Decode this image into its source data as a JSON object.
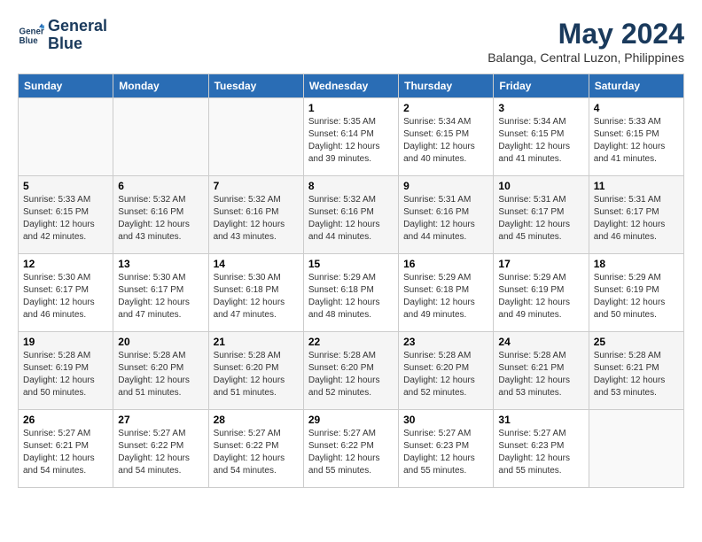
{
  "logo": {
    "line1": "General",
    "line2": "Blue"
  },
  "title": "May 2024",
  "location": "Balanga, Central Luzon, Philippines",
  "weekdays": [
    "Sunday",
    "Monday",
    "Tuesday",
    "Wednesday",
    "Thursday",
    "Friday",
    "Saturday"
  ],
  "weeks": [
    [
      {
        "day": "",
        "info": ""
      },
      {
        "day": "",
        "info": ""
      },
      {
        "day": "",
        "info": ""
      },
      {
        "day": "1",
        "info": "Sunrise: 5:35 AM\nSunset: 6:14 PM\nDaylight: 12 hours\nand 39 minutes."
      },
      {
        "day": "2",
        "info": "Sunrise: 5:34 AM\nSunset: 6:15 PM\nDaylight: 12 hours\nand 40 minutes."
      },
      {
        "day": "3",
        "info": "Sunrise: 5:34 AM\nSunset: 6:15 PM\nDaylight: 12 hours\nand 41 minutes."
      },
      {
        "day": "4",
        "info": "Sunrise: 5:33 AM\nSunset: 6:15 PM\nDaylight: 12 hours\nand 41 minutes."
      }
    ],
    [
      {
        "day": "5",
        "info": "Sunrise: 5:33 AM\nSunset: 6:15 PM\nDaylight: 12 hours\nand 42 minutes."
      },
      {
        "day": "6",
        "info": "Sunrise: 5:32 AM\nSunset: 6:16 PM\nDaylight: 12 hours\nand 43 minutes."
      },
      {
        "day": "7",
        "info": "Sunrise: 5:32 AM\nSunset: 6:16 PM\nDaylight: 12 hours\nand 43 minutes."
      },
      {
        "day": "8",
        "info": "Sunrise: 5:32 AM\nSunset: 6:16 PM\nDaylight: 12 hours\nand 44 minutes."
      },
      {
        "day": "9",
        "info": "Sunrise: 5:31 AM\nSunset: 6:16 PM\nDaylight: 12 hours\nand 44 minutes."
      },
      {
        "day": "10",
        "info": "Sunrise: 5:31 AM\nSunset: 6:17 PM\nDaylight: 12 hours\nand 45 minutes."
      },
      {
        "day": "11",
        "info": "Sunrise: 5:31 AM\nSunset: 6:17 PM\nDaylight: 12 hours\nand 46 minutes."
      }
    ],
    [
      {
        "day": "12",
        "info": "Sunrise: 5:30 AM\nSunset: 6:17 PM\nDaylight: 12 hours\nand 46 minutes."
      },
      {
        "day": "13",
        "info": "Sunrise: 5:30 AM\nSunset: 6:17 PM\nDaylight: 12 hours\nand 47 minutes."
      },
      {
        "day": "14",
        "info": "Sunrise: 5:30 AM\nSunset: 6:18 PM\nDaylight: 12 hours\nand 47 minutes."
      },
      {
        "day": "15",
        "info": "Sunrise: 5:29 AM\nSunset: 6:18 PM\nDaylight: 12 hours\nand 48 minutes."
      },
      {
        "day": "16",
        "info": "Sunrise: 5:29 AM\nSunset: 6:18 PM\nDaylight: 12 hours\nand 49 minutes."
      },
      {
        "day": "17",
        "info": "Sunrise: 5:29 AM\nSunset: 6:19 PM\nDaylight: 12 hours\nand 49 minutes."
      },
      {
        "day": "18",
        "info": "Sunrise: 5:29 AM\nSunset: 6:19 PM\nDaylight: 12 hours\nand 50 minutes."
      }
    ],
    [
      {
        "day": "19",
        "info": "Sunrise: 5:28 AM\nSunset: 6:19 PM\nDaylight: 12 hours\nand 50 minutes."
      },
      {
        "day": "20",
        "info": "Sunrise: 5:28 AM\nSunset: 6:20 PM\nDaylight: 12 hours\nand 51 minutes."
      },
      {
        "day": "21",
        "info": "Sunrise: 5:28 AM\nSunset: 6:20 PM\nDaylight: 12 hours\nand 51 minutes."
      },
      {
        "day": "22",
        "info": "Sunrise: 5:28 AM\nSunset: 6:20 PM\nDaylight: 12 hours\nand 52 minutes."
      },
      {
        "day": "23",
        "info": "Sunrise: 5:28 AM\nSunset: 6:20 PM\nDaylight: 12 hours\nand 52 minutes."
      },
      {
        "day": "24",
        "info": "Sunrise: 5:28 AM\nSunset: 6:21 PM\nDaylight: 12 hours\nand 53 minutes."
      },
      {
        "day": "25",
        "info": "Sunrise: 5:28 AM\nSunset: 6:21 PM\nDaylight: 12 hours\nand 53 minutes."
      }
    ],
    [
      {
        "day": "26",
        "info": "Sunrise: 5:27 AM\nSunset: 6:21 PM\nDaylight: 12 hours\nand 54 minutes."
      },
      {
        "day": "27",
        "info": "Sunrise: 5:27 AM\nSunset: 6:22 PM\nDaylight: 12 hours\nand 54 minutes."
      },
      {
        "day": "28",
        "info": "Sunrise: 5:27 AM\nSunset: 6:22 PM\nDaylight: 12 hours\nand 54 minutes."
      },
      {
        "day": "29",
        "info": "Sunrise: 5:27 AM\nSunset: 6:22 PM\nDaylight: 12 hours\nand 55 minutes."
      },
      {
        "day": "30",
        "info": "Sunrise: 5:27 AM\nSunset: 6:23 PM\nDaylight: 12 hours\nand 55 minutes."
      },
      {
        "day": "31",
        "info": "Sunrise: 5:27 AM\nSunset: 6:23 PM\nDaylight: 12 hours\nand 55 minutes."
      },
      {
        "day": "",
        "info": ""
      }
    ]
  ]
}
